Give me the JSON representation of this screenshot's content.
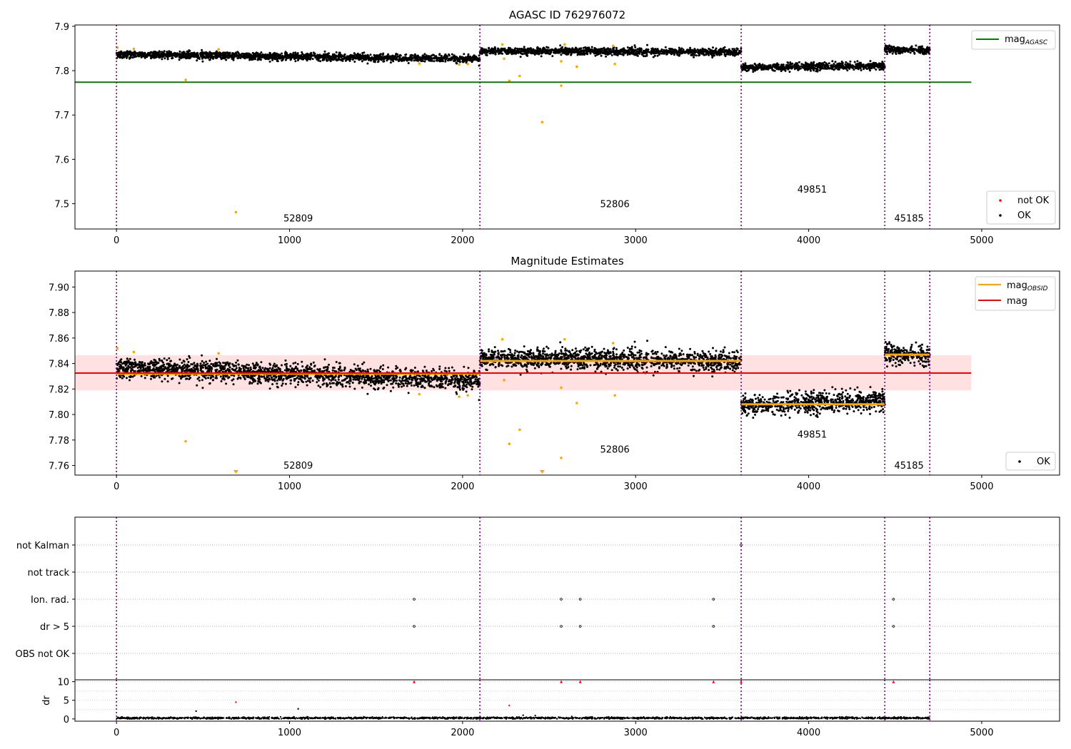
{
  "chart_data": [
    {
      "type": "scatter",
      "title": "AGASC ID 762976072",
      "xlabel": "",
      "ylabel": "",
      "xlim": [
        -240,
        5450
      ],
      "ylim": [
        7.443,
        7.903
      ],
      "xticks": [
        0,
        1000,
        2000,
        3000,
        4000,
        5000
      ],
      "yticks": [
        7.5,
        7.6,
        7.7,
        7.8,
        7.9
      ],
      "obsid_boundaries": [
        0,
        2100,
        3610,
        4440,
        4700
      ],
      "obsid_labels": [
        {
          "text": "52809",
          "x": 1050,
          "y": 7.46
        },
        {
          "text": "52806",
          "x": 2880,
          "y": 7.492
        },
        {
          "text": "49851",
          "x": 4020,
          "y": 7.525
        },
        {
          "text": "45185",
          "x": 4580,
          "y": 7.46
        }
      ],
      "agasc_mag": {
        "value": 7.774,
        "x": [
          -240,
          4940
        ]
      },
      "segments_ok": [
        {
          "x": [
            0,
            2100
          ],
          "y_start": 7.837,
          "y_end": 7.826,
          "spread": 0.005
        },
        {
          "x": [
            2100,
            3610
          ],
          "y_start": 7.844,
          "y_end": 7.842,
          "spread": 0.005
        },
        {
          "x": [
            3610,
            4440
          ],
          "y_start": 7.807,
          "y_end": 7.811,
          "spread": 0.005
        },
        {
          "x": [
            4440,
            4700
          ],
          "y_start": 7.848,
          "y_end": 7.846,
          "spread": 0.005
        }
      ],
      "outliers": [
        {
          "x": 5,
          "y": 7.852
        },
        {
          "x": 100,
          "y": 7.849
        },
        {
          "x": 400,
          "y": 7.779
        },
        {
          "x": 690,
          "y": 7.481
        },
        {
          "x": 590,
          "y": 7.848
        },
        {
          "x": 1750,
          "y": 7.816
        },
        {
          "x": 1980,
          "y": 7.814
        },
        {
          "x": 2030,
          "y": 7.815
        },
        {
          "x": 2230,
          "y": 7.859
        },
        {
          "x": 2240,
          "y": 7.827
        },
        {
          "x": 2270,
          "y": 7.777
        },
        {
          "x": 2330,
          "y": 7.788
        },
        {
          "x": 2460,
          "y": 7.684
        },
        {
          "x": 2570,
          "y": 7.766
        },
        {
          "x": 2570,
          "y": 7.821
        },
        {
          "x": 2590,
          "y": 7.859
        },
        {
          "x": 2660,
          "y": 7.809
        },
        {
          "x": 2870,
          "y": 7.856
        },
        {
          "x": 2880,
          "y": 7.815
        }
      ],
      "legend_lines": [
        {
          "label": "mag",
          "sub": "AGASC",
          "color": "#008000"
        }
      ],
      "legend_points": [
        {
          "label": "not OK",
          "color": "#ff0000"
        },
        {
          "label": "OK",
          "color": "#000000"
        }
      ],
      "colors": {
        "ok": "#000000",
        "outlier": "#ffa500",
        "agasc": "#008000",
        "boundary": "#800080"
      }
    },
    {
      "type": "scatter",
      "title": "Magnitude Estimates",
      "xlabel": "",
      "ylabel": "",
      "xlim": [
        -240,
        5450
      ],
      "ylim": [
        7.7525,
        7.9125
      ],
      "xticks": [
        0,
        1000,
        2000,
        3000,
        4000,
        5000
      ],
      "yticks": [
        7.76,
        7.78,
        7.8,
        7.82,
        7.84,
        7.86,
        7.88,
        7.9
      ],
      "obsid_boundaries": [
        0,
        2100,
        3610,
        4440,
        4700
      ],
      "obsid_labels": [
        {
          "text": "52809",
          "x": 1050,
          "y": 7.7575
        },
        {
          "text": "52806",
          "x": 2880,
          "y": 7.77
        },
        {
          "text": "49851",
          "x": 4020,
          "y": 7.782
        },
        {
          "text": "45185",
          "x": 4580,
          "y": 7.7575
        }
      ],
      "mean_mag": {
        "value": 7.8325,
        "band": [
          7.819,
          7.8465
        ],
        "x": [
          -240,
          4940
        ]
      },
      "obsid_mags": [
        {
          "x": [
            0,
            2100
          ],
          "y": 7.832
        },
        {
          "x": [
            2100,
            3610
          ],
          "y": 7.842
        },
        {
          "x": [
            3610,
            4440
          ],
          "y": 7.808
        },
        {
          "x": [
            4440,
            4700
          ],
          "y": 7.847
        }
      ],
      "segments_ok": [
        {
          "x": [
            0,
            2100
          ],
          "y_start": 7.837,
          "y_end": 7.826,
          "spread": 0.005
        },
        {
          "x": [
            2100,
            3610
          ],
          "y_start": 7.844,
          "y_end": 7.842,
          "spread": 0.005
        },
        {
          "x": [
            3610,
            4440
          ],
          "y_start": 7.807,
          "y_end": 7.811,
          "spread": 0.005
        },
        {
          "x": [
            4440,
            4700
          ],
          "y_start": 7.848,
          "y_end": 7.846,
          "spread": 0.005
        }
      ],
      "outliers": [
        {
          "x": 5,
          "y": 7.852
        },
        {
          "x": 100,
          "y": 7.849
        },
        {
          "x": 400,
          "y": 7.779
        },
        {
          "x": 590,
          "y": 7.848
        },
        {
          "x": 1750,
          "y": 7.816
        },
        {
          "x": 1980,
          "y": 7.814
        },
        {
          "x": 2030,
          "y": 7.815
        },
        {
          "x": 2230,
          "y": 7.859
        },
        {
          "x": 2240,
          "y": 7.827
        },
        {
          "x": 2270,
          "y": 7.777
        },
        {
          "x": 2330,
          "y": 7.788
        },
        {
          "x": 2570,
          "y": 7.766
        },
        {
          "x": 2570,
          "y": 7.821
        },
        {
          "x": 2590,
          "y": 7.859
        },
        {
          "x": 2660,
          "y": 7.809
        },
        {
          "x": 2870,
          "y": 7.856
        },
        {
          "x": 2880,
          "y": 7.815
        }
      ],
      "offscale_markers": [
        {
          "x": 690
        },
        {
          "x": 2460
        }
      ],
      "legend_lines": [
        {
          "label": "mag",
          "sub": "OBSID",
          "color": "#ffa500"
        },
        {
          "label": "mag",
          "sub": "",
          "color": "#ff0000"
        }
      ],
      "legend_points": [
        {
          "label": "OK",
          "color": "#000000"
        }
      ],
      "colors": {
        "ok": "#000000",
        "outlier": "#ffa500",
        "obsid": "#ffa500",
        "mean": "#ff0000",
        "band": "#ffdcdc",
        "boundary": "#800080"
      }
    },
    {
      "type": "scatter",
      "title": "",
      "xlabel": "",
      "ylabel": "",
      "xlim": [
        -240,
        5450
      ],
      "categories": [
        "not Kalman",
        "not track",
        "Ion. rad.",
        "dr > 5",
        "OBS not OK"
      ],
      "flags": [
        {
          "category": "not Kalman",
          "x": [
            3610
          ]
        },
        {
          "category": "not track",
          "x": []
        },
        {
          "category": "Ion. rad.",
          "x": [
            1720,
            2570,
            2680,
            3450,
            4490
          ]
        },
        {
          "category": "dr > 5",
          "x": [
            1720,
            2570,
            2680,
            3450,
            4490
          ]
        },
        {
          "category": "OBS not OK",
          "x": []
        }
      ],
      "obsid_boundaries": [
        0,
        2100,
        3610,
        4440,
        4700
      ],
      "colors": {
        "flag": "#000000",
        "boundary": "#800080"
      }
    },
    {
      "type": "scatter",
      "title": "",
      "xlabel": "",
      "ylabel": "dr",
      "xlim": [
        -240,
        5450
      ],
      "ylim": [
        -0.6,
        10.5
      ],
      "xticks": [
        0,
        1000,
        2000,
        3000,
        4000,
        5000
      ],
      "yticks": [
        0,
        5,
        10
      ],
      "base_dr": {
        "x": [
          0,
          4700
        ],
        "mean": 0.25,
        "spread": 0.2
      },
      "points": [
        {
          "x": 460,
          "y": 2.1
        },
        {
          "x": 1050,
          "y": 2.7
        },
        {
          "x": 690,
          "y": 4.5
        },
        {
          "x": 2270,
          "y": 3.6
        },
        {
          "x": 2350,
          "y": 1.0
        },
        {
          "x": 2420,
          "y": 0.9
        }
      ],
      "high_points": [
        {
          "x": 1720,
          "y": 10
        },
        {
          "x": 2570,
          "y": 10
        },
        {
          "x": 2680,
          "y": 10
        },
        {
          "x": 3450,
          "y": 10
        },
        {
          "x": 3610,
          "y": 10
        },
        {
          "x": 4490,
          "y": 10
        }
      ],
      "obsid_boundaries": [
        0,
        2100,
        3610,
        4440,
        4700
      ],
      "colors": {
        "ok": "#000000",
        "high": "#ff0000",
        "boundary": "#800080"
      }
    }
  ]
}
